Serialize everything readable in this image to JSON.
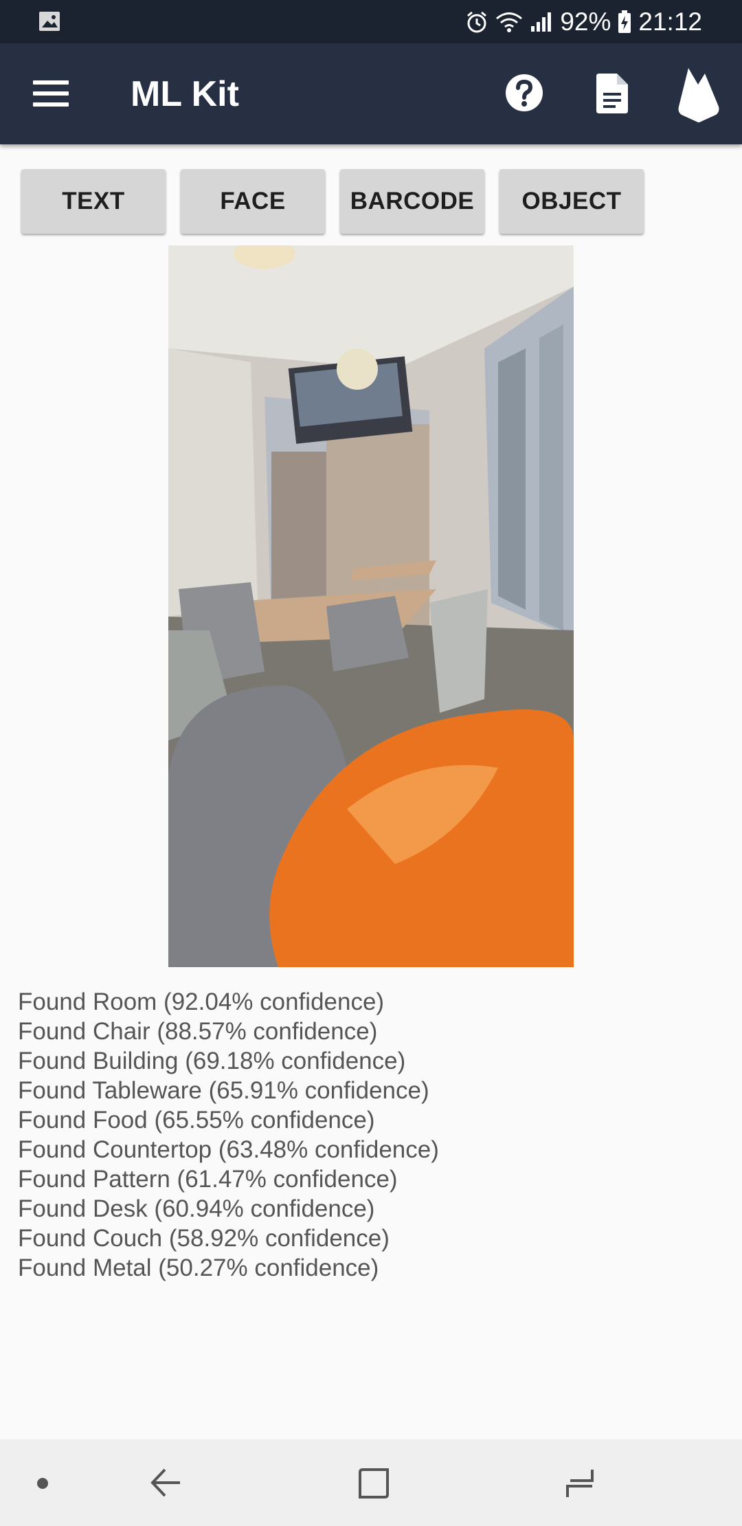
{
  "status_bar": {
    "battery": "92%",
    "time": "21:12",
    "icons": [
      "image-icon",
      "alarm-icon",
      "wifi-icon",
      "signal-icon",
      "battery-charging-icon"
    ]
  },
  "app_bar": {
    "title": "ML Kit",
    "icons": [
      "menu-icon",
      "help-icon",
      "document-icon",
      "firebase-icon"
    ],
    "background_color": "#263042"
  },
  "tabs": [
    {
      "label": "TEXT"
    },
    {
      "label": "FACE"
    },
    {
      "label": "BARCODE"
    },
    {
      "label": "OBJECT"
    }
  ],
  "results": [
    {
      "text": "Found Room (92.04% confidence)"
    },
    {
      "text": "Found Chair (88.57% confidence)"
    },
    {
      "text": "Found Building (69.18% confidence)"
    },
    {
      "text": "Found Tableware (65.91% confidence)"
    },
    {
      "text": "Found Food (65.55% confidence)"
    },
    {
      "text": "Found Countertop (63.48% confidence)"
    },
    {
      "text": "Found Pattern (61.47% confidence)"
    },
    {
      "text": "Found Desk (60.94% confidence)"
    },
    {
      "text": "Found Couch (58.92% confidence)"
    },
    {
      "text": "Found Metal (50.27% confidence)"
    }
  ],
  "nav_bar": {
    "icons": [
      "nav-dot-icon",
      "back-icon",
      "home-icon",
      "recents-icon"
    ]
  }
}
